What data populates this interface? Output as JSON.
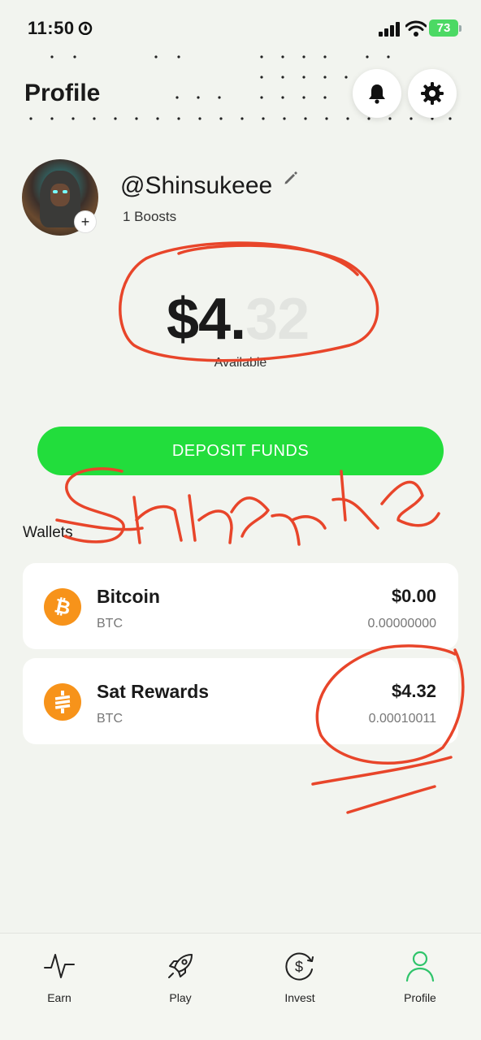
{
  "status_bar": {
    "time": "11:50",
    "battery": "73"
  },
  "header": {
    "title": "Profile"
  },
  "icons": {
    "notifications": "bell-icon",
    "settings": "gear-icon",
    "edit": "pencil-icon",
    "add_avatar": "plus-icon"
  },
  "profile": {
    "username": "@Shinsukeee",
    "boosts": "1 Boosts",
    "add_symbol": "+"
  },
  "balance": {
    "main": "$4.",
    "cents": "32",
    "label": "Available"
  },
  "deposit_button": {
    "label": "DEPOSIT FUNDS"
  },
  "wallets": {
    "title": "Wallets",
    "items": [
      {
        "name": "Bitcoin",
        "currency": "BTC",
        "usd": "$0.00",
        "btc": "0.00000000",
        "icon": "bitcoin-icon"
      },
      {
        "name": "Sat Rewards",
        "currency": "BTC",
        "usd": "$4.32",
        "btc": "0.00010011",
        "icon": "sat-icon"
      }
    ]
  },
  "nav": {
    "items": [
      {
        "label": "Earn",
        "icon": "activity-icon"
      },
      {
        "label": "Play",
        "icon": "rocket-icon"
      },
      {
        "label": "Invest",
        "icon": "dollar-cycle-icon"
      },
      {
        "label": "Profile",
        "icon": "person-icon"
      }
    ]
  },
  "colors": {
    "accent_green": "#22dd3c",
    "bitcoin_orange": "#f7931a",
    "annotation_red": "#e8452a",
    "profile_active": "#2fc46b"
  }
}
